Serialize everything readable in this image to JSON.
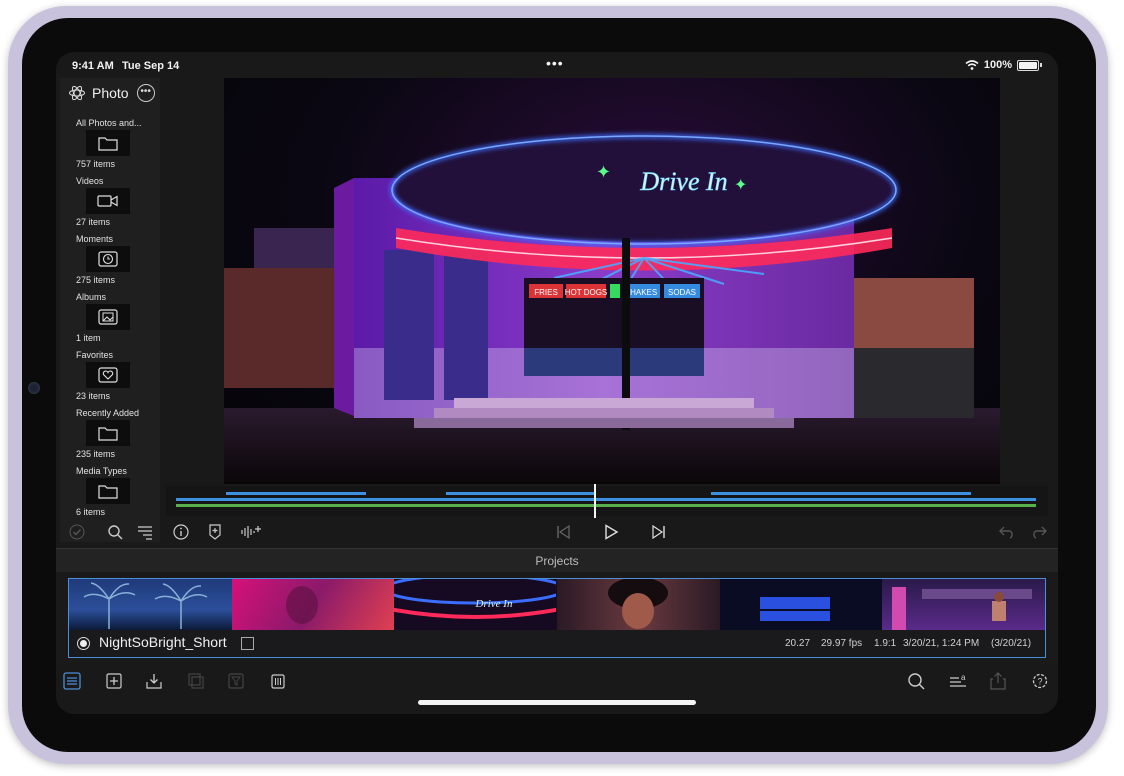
{
  "status": {
    "time": "9:41 AM",
    "date": "Tue Sep 14",
    "dots": "•••",
    "battery": "100%"
  },
  "sidebar": {
    "title": "Photo",
    "items": [
      {
        "label": "All Photos and...",
        "count": "757 items",
        "icon": "folder-icon"
      },
      {
        "label": "Videos",
        "count": "27 items",
        "icon": "video-camera-icon"
      },
      {
        "label": "Moments",
        "count": "275 items",
        "icon": "clock-icon"
      },
      {
        "label": "Albums",
        "count": "1 item",
        "icon": "photos-stack-icon"
      },
      {
        "label": "Favorites",
        "count": "23 items",
        "icon": "heart-icon"
      },
      {
        "label": "Recently Added",
        "count": "235 items",
        "icon": "folder-icon"
      },
      {
        "label": "Media Types",
        "count": "6 items",
        "icon": "folder-icon"
      }
    ]
  },
  "viewer": {
    "signs": {
      "main": "Drive In",
      "fries": "FRIES",
      "hotdogs": "HOT DOGS",
      "shakes": "SHAKES",
      "sodas": "SODAS"
    }
  },
  "projects": {
    "header": "Projects",
    "items": [
      {
        "name": "NightSoBright_Short",
        "duration": "20.27",
        "fps": "29.97 fps",
        "aspect": "1.9:1",
        "date": "3/20/21, 1:24 PM",
        "created": "(3/20/21)"
      }
    ]
  },
  "colors": {
    "accent": "#4d8fd6",
    "timeline_blue": "#3d8fe0",
    "timeline_green": "#58b04c"
  }
}
